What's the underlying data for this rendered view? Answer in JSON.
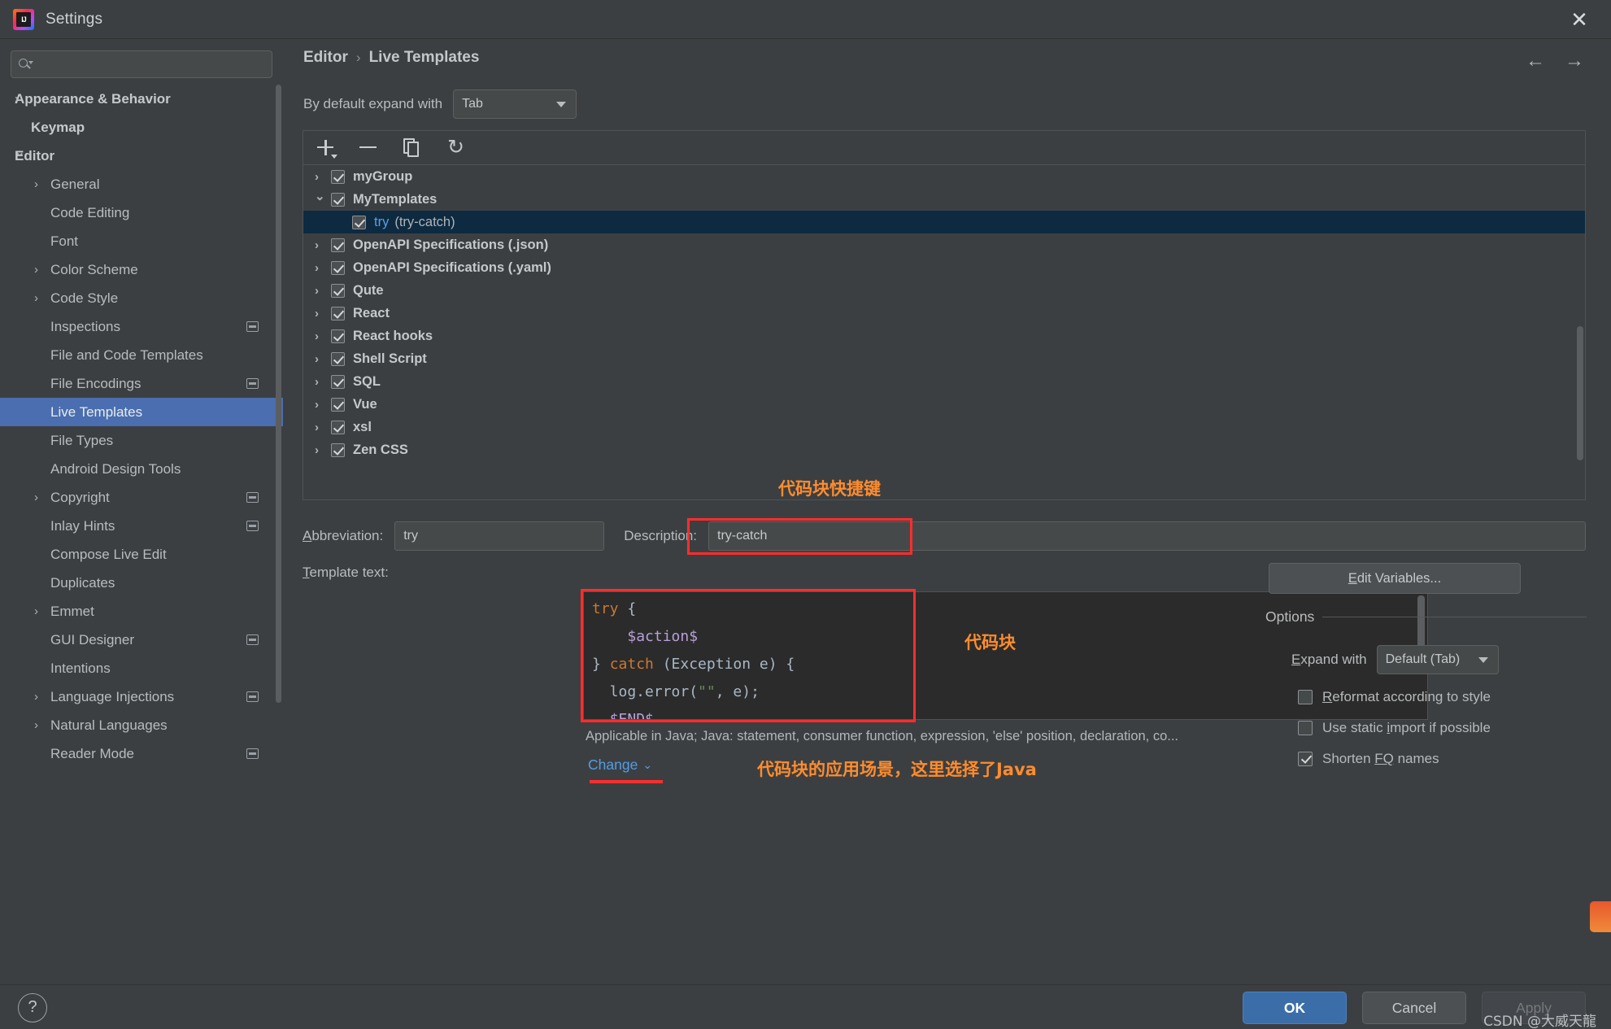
{
  "window": {
    "title": "Settings",
    "logo_text": "IJ",
    "close_icon": "✕"
  },
  "sidebar": {
    "search": {
      "value": "",
      "placeholder": ""
    },
    "items": [
      {
        "label": "Appearance & Behavior",
        "level": 0,
        "arrow": "right",
        "badge": false
      },
      {
        "label": "Keymap",
        "level": 0,
        "arrow": "none",
        "badge": false
      },
      {
        "label": "Editor",
        "level": 0,
        "arrow": "down",
        "badge": false
      },
      {
        "label": "General",
        "level": 1,
        "arrow": "right",
        "badge": false
      },
      {
        "label": "Code Editing",
        "level": 1,
        "arrow": "none",
        "badge": false
      },
      {
        "label": "Font",
        "level": 1,
        "arrow": "none",
        "badge": false
      },
      {
        "label": "Color Scheme",
        "level": 1,
        "arrow": "right",
        "badge": false
      },
      {
        "label": "Code Style",
        "level": 1,
        "arrow": "right",
        "badge": false
      },
      {
        "label": "Inspections",
        "level": 1,
        "arrow": "none",
        "badge": true
      },
      {
        "label": "File and Code Templates",
        "level": 1,
        "arrow": "none",
        "badge": false
      },
      {
        "label": "File Encodings",
        "level": 1,
        "arrow": "none",
        "badge": true
      },
      {
        "label": "Live Templates",
        "level": 1,
        "arrow": "none",
        "badge": false,
        "selected": true
      },
      {
        "label": "File Types",
        "level": 1,
        "arrow": "none",
        "badge": false
      },
      {
        "label": "Android Design Tools",
        "level": 1,
        "arrow": "none",
        "badge": false
      },
      {
        "label": "Copyright",
        "level": 1,
        "arrow": "right",
        "badge": true
      },
      {
        "label": "Inlay Hints",
        "level": 1,
        "arrow": "none",
        "badge": true
      },
      {
        "label": "Compose Live Edit",
        "level": 1,
        "arrow": "none",
        "badge": false
      },
      {
        "label": "Duplicates",
        "level": 1,
        "arrow": "none",
        "badge": false
      },
      {
        "label": "Emmet",
        "level": 1,
        "arrow": "right",
        "badge": false
      },
      {
        "label": "GUI Designer",
        "level": 1,
        "arrow": "none",
        "badge": true
      },
      {
        "label": "Intentions",
        "level": 1,
        "arrow": "none",
        "badge": false
      },
      {
        "label": "Language Injections",
        "level": 1,
        "arrow": "right",
        "badge": true
      },
      {
        "label": "Natural Languages",
        "level": 1,
        "arrow": "right",
        "badge": false
      },
      {
        "label": "Reader Mode",
        "level": 1,
        "arrow": "none",
        "badge": true
      }
    ]
  },
  "main": {
    "breadcrumb": {
      "root": "Editor",
      "separator": "›",
      "current": "Live Templates"
    },
    "nav": {
      "back_icon": "←",
      "forward_icon": "→"
    },
    "expand_row": {
      "label": "By default expand with",
      "value": "Tab"
    },
    "toolbar": {
      "add_label": "add-template",
      "remove_label": "remove-template",
      "duplicate_label": "duplicate-template",
      "revert_label": "revert-changes",
      "revert_icon": "↺"
    },
    "templates": [
      {
        "label": "myGroup",
        "arrow": "right",
        "checked": true,
        "child": false
      },
      {
        "label": "MyTemplates",
        "arrow": "down",
        "checked": true,
        "child": false
      },
      {
        "abbr": "try",
        "desc": "(try-catch)",
        "arrow": "none",
        "checked": true,
        "child": true,
        "selected": true
      },
      {
        "label": "OpenAPI Specifications (.json)",
        "arrow": "right",
        "checked": true,
        "child": false
      },
      {
        "label": "OpenAPI Specifications (.yaml)",
        "arrow": "right",
        "checked": true,
        "child": false
      },
      {
        "label": "Qute",
        "arrow": "right",
        "checked": true,
        "child": false
      },
      {
        "label": "React",
        "arrow": "right",
        "checked": true,
        "child": false
      },
      {
        "label": "React hooks",
        "arrow": "right",
        "checked": true,
        "child": false
      },
      {
        "label": "Shell Script",
        "arrow": "right",
        "checked": true,
        "child": false
      },
      {
        "label": "SQL",
        "arrow": "right",
        "checked": true,
        "child": false
      },
      {
        "label": "Vue",
        "arrow": "right",
        "checked": true,
        "child": false
      },
      {
        "label": "xsl",
        "arrow": "right",
        "checked": true,
        "child": false
      },
      {
        "label": "Zen CSS",
        "arrow": "right",
        "checked": true,
        "child": false
      }
    ],
    "abbreviation": {
      "label": "Abbreviation:",
      "label_pre": "A",
      "label_key": "b",
      "label_post": "breviation:",
      "value": "try"
    },
    "description": {
      "label": "Description:",
      "value": "try-catch"
    },
    "template_text": {
      "label": "Template text:",
      "label_key": "T",
      "label_post": "emplate text:",
      "lines": [
        {
          "tokens": [
            {
              "t": "try",
              "c": "k"
            },
            {
              "t": " {",
              "c": "p"
            }
          ]
        },
        {
          "tokens": [
            {
              "t": "    ",
              "c": "p"
            },
            {
              "t": "$action$",
              "c": "v"
            }
          ]
        },
        {
          "tokens": [
            {
              "t": "} ",
              "c": "p"
            },
            {
              "t": "catch",
              "c": "k"
            },
            {
              "t": " (Exception e) {",
              "c": "p"
            }
          ]
        },
        {
          "tokens": [
            {
              "t": "  log.error(",
              "c": "m"
            },
            {
              "t": "\"\"",
              "c": "s"
            },
            {
              "t": ", e);",
              "c": "m"
            }
          ]
        },
        {
          "tokens": [
            {
              "t": "  ",
              "c": "p"
            },
            {
              "t": "$END$",
              "c": "v"
            }
          ]
        }
      ]
    },
    "applicable": "Applicable in Java; Java: statement, consumer function, expression, 'else' position, declaration, co...",
    "change_link": {
      "label": "Change",
      "chevron": "⌄"
    },
    "edit_variables": {
      "label": "Edit Variables...",
      "label_key": "E",
      "label_post": "dit Variables..."
    },
    "options": {
      "title": "Options",
      "expand_with": {
        "label": "Expand with",
        "label_key": "E",
        "label_post": "xpand with",
        "value": "Default (Tab)"
      },
      "checkboxes": [
        {
          "label": "Reformat according to style",
          "key": "R",
          "post": "eformat according to style",
          "checked": false
        },
        {
          "label": "Use static import if possible",
          "pre": "Use static ",
          "key": "i",
          "post": "mport if possible",
          "checked": false
        },
        {
          "label": "Shorten FQ names",
          "pre": "Shorten ",
          "key": "FQ",
          "post": " names",
          "checked": true
        }
      ]
    }
  },
  "annotations": {
    "shortcut": "代码块快捷键",
    "codeblock": "代码块",
    "scope": "代码块的应用场景，这里选择了Java",
    "color": "#ff8c2e",
    "box_color": "#ff2d2d"
  },
  "footer": {
    "help_icon": "?",
    "ok": "OK",
    "cancel": "Cancel",
    "apply": "Apply",
    "watermark": "CSDN @大威天龍"
  }
}
